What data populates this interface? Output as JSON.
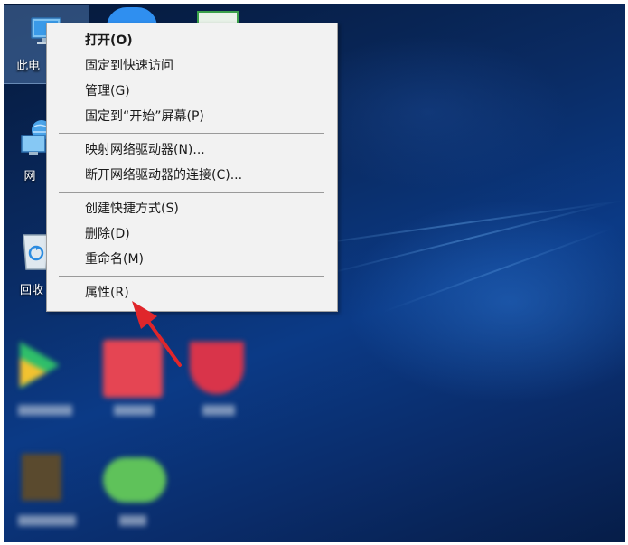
{
  "desktop": {
    "icons": [
      {
        "label": "此电",
        "selected": true
      },
      {
        "label": "网"
      },
      {
        "label": "回收"
      }
    ]
  },
  "context_menu": {
    "groups": [
      [
        {
          "label": "打开(O)",
          "bold": true
        },
        {
          "label": "固定到快速访问"
        },
        {
          "label": "管理(G)"
        },
        {
          "label": "固定到“开始”屏幕(P)"
        }
      ],
      [
        {
          "label": "映射网络驱动器(N)..."
        },
        {
          "label": "断开网络驱动器的连接(C)..."
        }
      ],
      [
        {
          "label": "创建快捷方式(S)"
        },
        {
          "label": "删除(D)"
        },
        {
          "label": "重命名(M)"
        }
      ],
      [
        {
          "label": "属性(R)",
          "highlighted_by_arrow": true
        }
      ]
    ]
  },
  "colors": {
    "arrow": "#e0262b",
    "menu_background": "#f2f2f2",
    "desktop_top": "#05193a",
    "desktop_mid": "#0b3a86"
  }
}
